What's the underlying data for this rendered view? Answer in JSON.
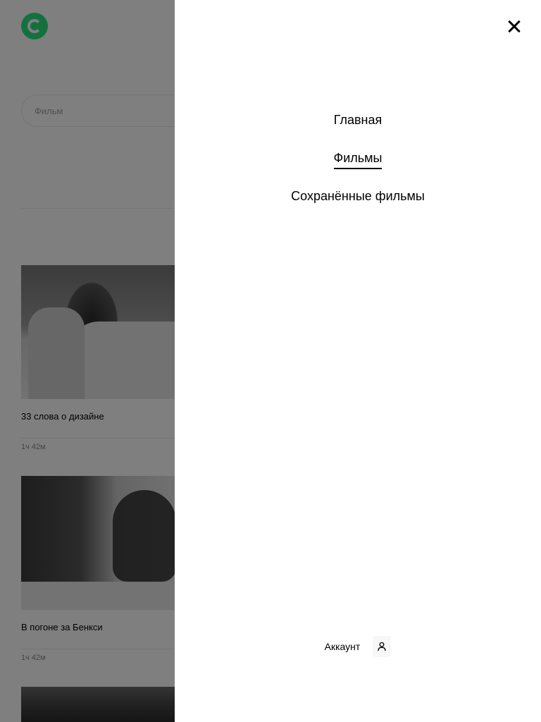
{
  "search": {
    "placeholder": "Фильм"
  },
  "movies": [
    {
      "title": "33 слова о дизайне",
      "duration": "1ч 42м"
    },
    {
      "title": "В погоне за Бенкси",
      "duration": "1ч 42м"
    }
  ],
  "menu": {
    "items": [
      {
        "label": "Главная",
        "active": false
      },
      {
        "label": "Фильмы",
        "active": true
      },
      {
        "label": "Сохранённые фильмы",
        "active": false
      }
    ],
    "account_label": "Аккаунт"
  },
  "icons": {
    "logo": "logo-icon",
    "close": "close-icon",
    "account": "account-icon"
  },
  "colors": {
    "brand": "#2BE080",
    "overlay": "rgba(0,0,0,0.5)"
  }
}
